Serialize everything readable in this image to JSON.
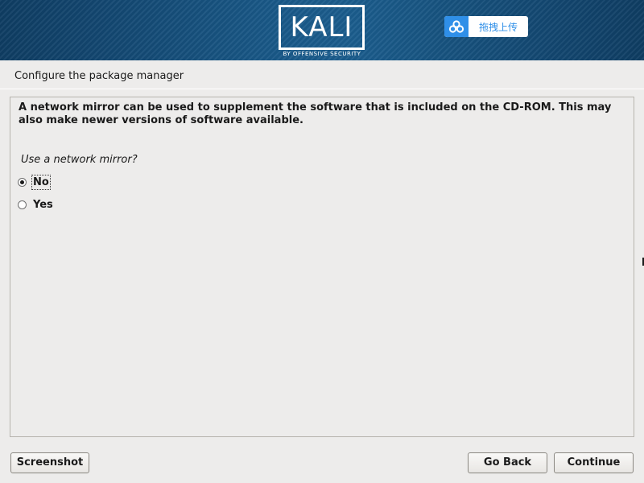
{
  "banner": {
    "logo_text": "KALI",
    "logo_subtitle": "BY OFFENSIVE SECURITY",
    "upload_button_label": "拖拽上传",
    "brand_color": "#1a5a8a",
    "upload_accent": "#2f8fe8"
  },
  "page": {
    "title": "Configure the package manager"
  },
  "content": {
    "description": "A network mirror can be used to supplement the software that is included on the CD-ROM. This may also make newer versions of software available.",
    "question": "Use a network mirror?",
    "options": [
      {
        "label": "No",
        "selected": true
      },
      {
        "label": "Yes",
        "selected": false
      }
    ]
  },
  "buttons": {
    "screenshot": "Screenshot",
    "go_back": "Go Back",
    "continue": "Continue"
  },
  "icons": {
    "upload": "cloud-link-icon",
    "radio_selected": "radio-checked-icon",
    "radio_unselected": "radio-unchecked-icon"
  }
}
